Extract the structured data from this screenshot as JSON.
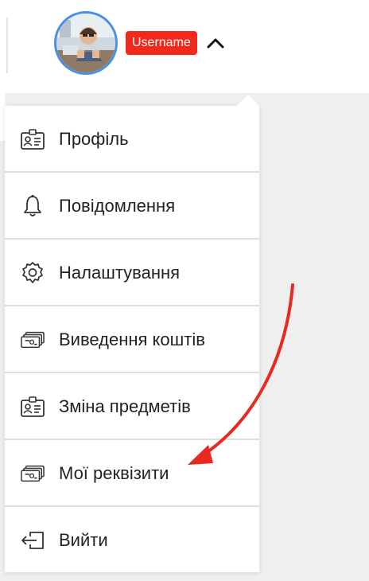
{
  "header": {
    "username": "Username"
  },
  "menu": {
    "items": [
      {
        "label": "Профіль",
        "icon": "profile-card-icon"
      },
      {
        "label": "Повідомлення",
        "icon": "bell-icon"
      },
      {
        "label": "Налаштування",
        "icon": "gear-icon"
      },
      {
        "label": "Виведення коштів",
        "icon": "money-icon"
      },
      {
        "label": "Зміна предметів",
        "icon": "profile-card-icon"
      },
      {
        "label": "Мої реквізити",
        "icon": "money-icon"
      },
      {
        "label": "Вийти",
        "icon": "logout-icon"
      }
    ]
  },
  "colors": {
    "avatar_ring": "#4a90e2",
    "annotation_arrow": "#e8291e",
    "redaction": "#f0291d"
  }
}
